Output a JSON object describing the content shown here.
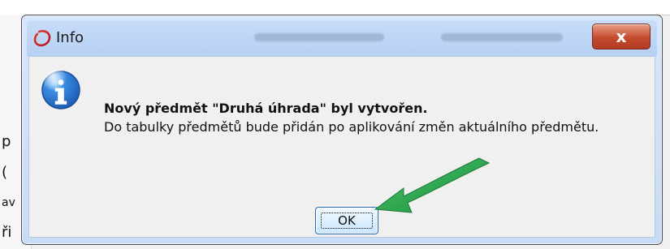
{
  "background": {
    "left_chars": [
      "p",
      "(",
      "av",
      "ři"
    ]
  },
  "dialog": {
    "title": "Info",
    "close_label": "x",
    "message": {
      "line1": "Nový předmět \"Druhá úhrada\" byl vytvořen.",
      "line2": "Do tabulky předmětů bude přidán po aplikování změn aktuálního předmětu."
    },
    "ok_label": "OK"
  },
  "icons": {
    "title_icon": "oracle-ring-icon",
    "info_icon": "info-icon",
    "arrow_annotation": "green-arrow-icon"
  },
  "colors": {
    "close_red": "#c64b2f",
    "titlebar_blue": "#c7dcf8",
    "content_gray": "#f0f0f0",
    "arrow_green": "#2ea84b",
    "info_blue": "#1f5fb8"
  }
}
